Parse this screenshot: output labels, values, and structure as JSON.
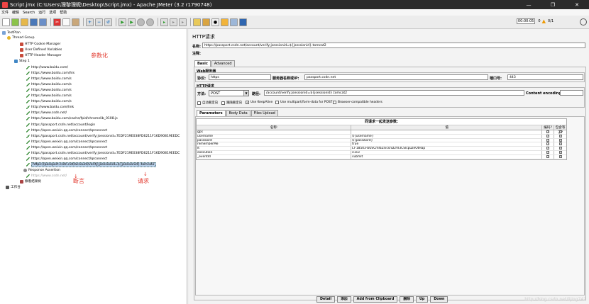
{
  "window": {
    "title": "Script.jmx (C:\\Users\\理黎理眤\\Desktop\\Script.jmx) - Apache JMeter (3.2 r1790748)",
    "minimize": "—",
    "maximize": "❐",
    "close": "✕"
  },
  "menu": [
    "文件",
    "编辑",
    "Search",
    "运行",
    "选项",
    "帮助"
  ],
  "status": {
    "elapsed": "00:00:05",
    "errors": "0",
    "threads": "0/1"
  },
  "tree": [
    {
      "label": "TestPlan",
      "icon": "plan"
    },
    {
      "label": "Thread Group",
      "icon": "thread"
    },
    {
      "label": "HTTP Cookie Manager",
      "icon": "config"
    },
    {
      "label": "User Defined Variables",
      "icon": "config"
    },
    {
      "label": "HTTP Header Manager",
      "icon": "config"
    },
    {
      "label": "Step 1",
      "icon": "step"
    },
    {
      "label": "http://www.baidu.com/",
      "icon": "sampler"
    },
    {
      "label": "https://www.baidu.com/his",
      "icon": "sampler"
    },
    {
      "label": "https://www.baidu.com/s",
      "icon": "sampler"
    },
    {
      "label": "https://www.baidu.com/s",
      "icon": "sampler"
    },
    {
      "label": "https://www.baidu.com/s",
      "icon": "sampler"
    },
    {
      "label": "https://www.baidu.com/s",
      "icon": "sampler"
    },
    {
      "label": "https://www.baidu.com/s",
      "icon": "sampler"
    },
    {
      "label": "http://www.baidu.com/link",
      "icon": "sampler"
    },
    {
      "label": "https://www.csdn.net/",
      "icon": "sampler"
    },
    {
      "label": "https://www.baidu.com/cache/fpid/chromelib_0108.js",
      "icon": "sampler"
    },
    {
      "label": "https://passport.csdn.net/account/login",
      "icon": "sampler"
    },
    {
      "label": "https://open.weixin.qq.com/connect/qrconnect",
      "icon": "sampler"
    },
    {
      "label": "https://passport.csdn.net/account/verify;jsessionid=7EDF219E038FD6211F16D90819EEDC",
      "icon": "sampler"
    },
    {
      "label": "https://open.weixin.qq.com/connect/qrconnect",
      "icon": "sampler"
    },
    {
      "label": "https://open.weixin.qq.com/connect/qrconnect",
      "icon": "sampler"
    },
    {
      "label": "https://passport.csdn.net/account/verify;jsessionid=7EDF219E038FD6211F16D90819EEDC",
      "icon": "sampler"
    },
    {
      "label": "https://open.weixin.qq.com/connect/qrconnect",
      "icon": "sampler"
    },
    {
      "label": "https://passport.csdn.net/account/verify;jsessionid=${jsessionid}.tomcat2",
      "icon": "sampler",
      "selected": true
    },
    {
      "label": "Response Assertion",
      "icon": "assert"
    },
    {
      "label": "https://www.csdn.net/",
      "icon": "sampler",
      "disabled": true
    },
    {
      "label": "察看结果树",
      "icon": "listen"
    },
    {
      "label": "工作台",
      "icon": "bench"
    }
  ],
  "annotations": {
    "params": "参数化",
    "assert": "断言",
    "request": "请求"
  },
  "sampler": {
    "panel_title": "HTTP请求",
    "name_label": "名称:",
    "name_value": "https://passport.csdn.net/account/verify;jsessionid=${jsessionid}.tomcat2",
    "comment_label": "注释:",
    "tabs": [
      "Basic",
      "Advanced"
    ],
    "web_server_title": "Web服务器",
    "protocol_label": "协议:",
    "protocol_value": "https",
    "server_label": "服务器名称或IP:",
    "server_value": "passport.csdn.net",
    "port_label": "端口号:",
    "port_value": "443",
    "http_request_title": "HTTP请求",
    "method_label": "方法:",
    "method_value": "POST",
    "path_label": "路径:",
    "path_value": "/account/verify;jsessionid=${jsessionid}.tomcat2",
    "encoding_label": "Content encoding:",
    "options": [
      {
        "label": "自动重定向",
        "checked": false
      },
      {
        "label": "跟随重定向",
        "checked": false
      },
      {
        "label": "Use KeepAlive",
        "checked": true
      },
      {
        "label": "Use multipart/form-data for POST",
        "checked": false
      },
      {
        "label": "Browser-compatible headers",
        "checked": false
      }
    ],
    "param_tabs": [
      "Parameters",
      "Body Data",
      "Files Upload"
    ],
    "table_caption": "同请求一起发送参数:",
    "columns": [
      "名称:",
      "值",
      "编码?",
      "包含等于?"
    ],
    "params": [
      {
        "name": "gps",
        "value": "",
        "encode": true,
        "include_eq": true
      },
      {
        "name": "username",
        "value": "${username}",
        "encode": true,
        "include_eq": true
      },
      {
        "name": "password",
        "value": "${password}",
        "encode": true,
        "include_eq": true
      },
      {
        "name": "rememberMe",
        "value": "true",
        "encode": true,
        "include_eq": true
      },
      {
        "name": "lt",
        "value": "LT-18503-bUSCml6ZlvcsnD2VI3CSlcpuzeOtHap",
        "encode": true,
        "include_eq": true
      },
      {
        "name": "execution",
        "value": "e1s3",
        "encode": true,
        "include_eq": true
      },
      {
        "name": "_eventId",
        "value": "submit",
        "encode": true,
        "include_eq": true
      }
    ],
    "buttons": [
      "Detail",
      "添加",
      "Add from Clipboard",
      "删除",
      "Up",
      "Down"
    ]
  },
  "watermark": "http://blog.csdn.net/lijing742"
}
